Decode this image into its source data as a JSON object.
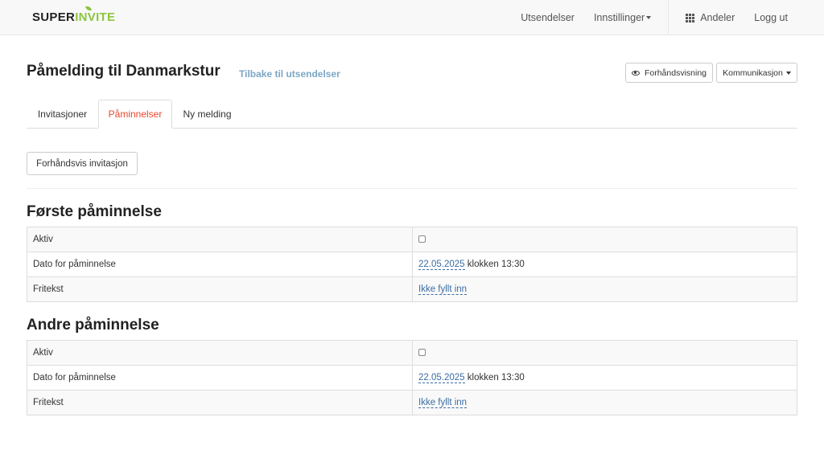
{
  "navbar": {
    "brand_super": "SUPER",
    "brand_invite": "INVITE",
    "items": [
      "Utsendelser",
      "Innstillinger",
      "Andeler",
      "Logg ut"
    ]
  },
  "header": {
    "title": "Påmelding til Danmarkstur",
    "back_link": "Tilbake til utsendelser",
    "preview_button": "Forhåndsvisning",
    "communication_button": "Kommunikasjon"
  },
  "tabs": [
    {
      "label": "Invitasjoner",
      "active": false
    },
    {
      "label": "Påminnelser",
      "active": true
    },
    {
      "label": "Ny melding",
      "active": false
    }
  ],
  "preview_invitation_button": "Forhåndsvis invitasjon",
  "reminders": [
    {
      "title": "Første påminnelse",
      "rows": {
        "active_label": "Aktiv",
        "date_label": "Dato for påminnelse",
        "date_value": "22.05.2025",
        "time_text": "klokken 13:30",
        "freetext_label": "Fritekst",
        "freetext_value": "Ikke fyllt inn"
      }
    },
    {
      "title": "Andre påminnelse",
      "rows": {
        "active_label": "Aktiv",
        "date_label": "Dato for påminnelse",
        "date_value": "22.05.2025",
        "time_text": "klokken 13:30",
        "freetext_label": "Fritekst",
        "freetext_value": "Ikke fyllt inn"
      }
    }
  ],
  "colors": {
    "accent_green": "#8cc63f",
    "active_tab": "#e8472b",
    "link": "#3a6da3"
  }
}
